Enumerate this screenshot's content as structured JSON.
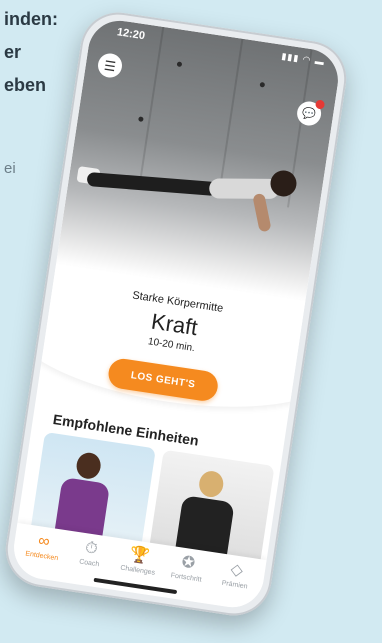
{
  "background_text": {
    "line1": "inden:",
    "line2": "er",
    "line3": "eben",
    "line4": "ei"
  },
  "status_bar": {
    "time": "12:20",
    "icons": "▮▮▮ ◠ ▬"
  },
  "header": {
    "menu_icon": "hamburger-icon",
    "chat_icon": "chat-icon"
  },
  "hero": {
    "subtitle": "Starke Körpermitte",
    "title": "Kraft",
    "duration": "10-20 min.",
    "cta_label": "LOS GEHT'S"
  },
  "recommended": {
    "title": "Empfohlene Einheiten"
  },
  "tabs": [
    {
      "label": "Entdecken",
      "icon": "binoculars-icon",
      "glyph": "∞",
      "active": true
    },
    {
      "label": "Coach",
      "icon": "stopwatch-icon",
      "glyph": "⏱",
      "active": false
    },
    {
      "label": "Challenges",
      "icon": "trophy-icon",
      "glyph": "🏆",
      "active": false
    },
    {
      "label": "Fortschritt",
      "icon": "star-badge-icon",
      "glyph": "✪",
      "active": false
    },
    {
      "label": "Prämien",
      "icon": "diamond-icon",
      "glyph": "◇",
      "active": false
    }
  ],
  "colors": {
    "accent": "#f58a1f",
    "notification": "#e53935",
    "background": "#d2eaf2"
  }
}
